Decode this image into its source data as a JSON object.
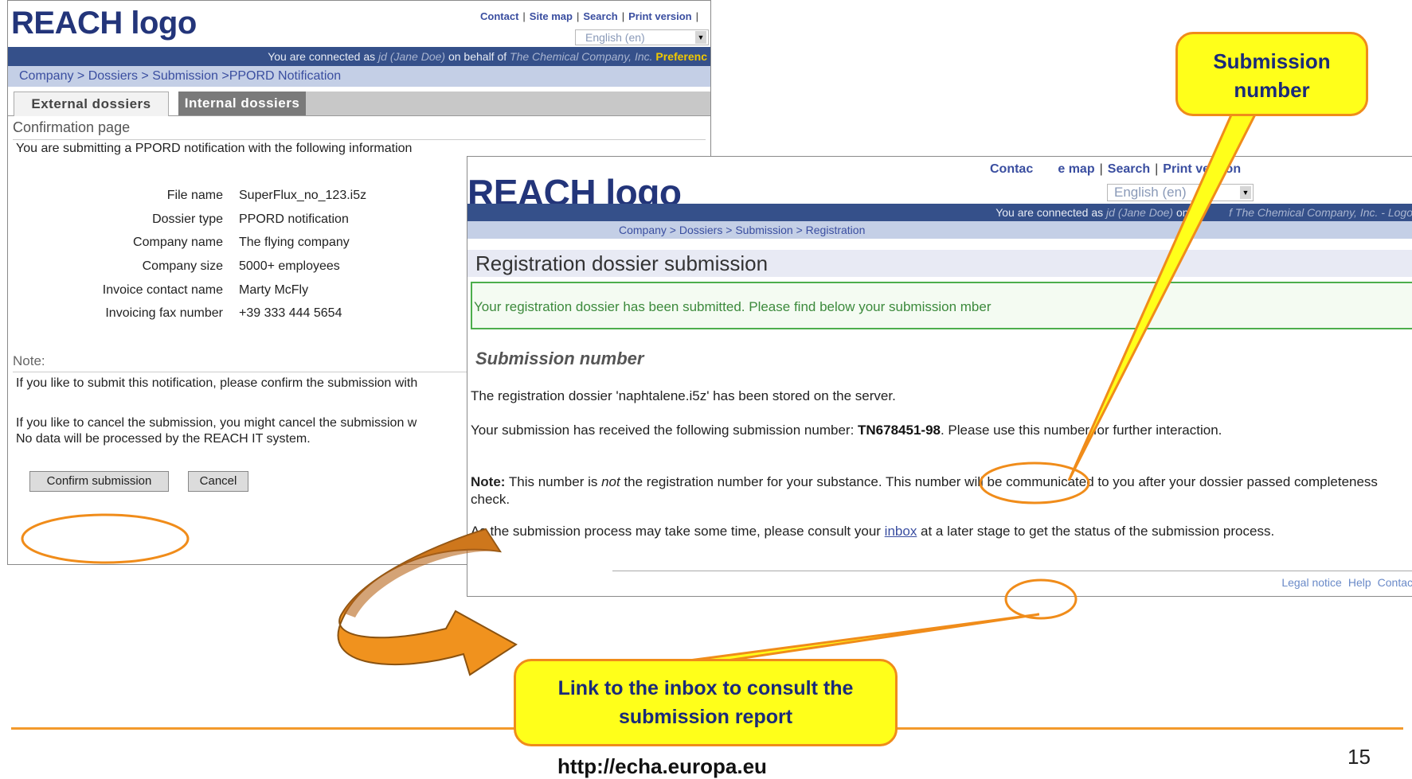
{
  "window1": {
    "logo": "REACH logo",
    "top_links": [
      "Contact",
      "Site map",
      "Search",
      "Print version"
    ],
    "language": "English (en)",
    "connected_prefix": "You are connected as ",
    "connected_user": "jd (Jane Doe)",
    "connected_mid": " on behalf of ",
    "connected_company": "The Chemical Company, Inc.",
    "connected_pref": " Preferenc",
    "breadcrumb": [
      "Company",
      "Dossiers",
      "Submission"
    ],
    "breadcrumb_current": ">PPORD Notification",
    "tabs": {
      "external": "External dossiers",
      "internal": "Internal dossiers"
    },
    "confirmation_header": "Confirmation page",
    "intro": "You are submitting a PPORD notification with the following information",
    "fields": [
      {
        "label": "File name",
        "value": "SuperFlux_no_123.i5z"
      },
      {
        "label": "Dossier type",
        "value": "PPORD notification"
      },
      {
        "label": "Company name",
        "value": "The flying company"
      },
      {
        "label": "Company size",
        "value": "5000+ employees"
      },
      {
        "label": "Invoice contact name",
        "value": "Marty McFly"
      },
      {
        "label": "Invoicing fax number",
        "value": "+39 333 444 5654"
      }
    ],
    "note_header": "Note:",
    "note_line1": "If you like to submit this notification, please confirm the submission with",
    "note_line2a": "If you like to cancel the submission, you might cancel the submission w",
    "note_line2b": "No data will be processed by the REACH IT system.",
    "confirm_button": "Confirm submission",
    "cancel_button": "Cancel"
  },
  "window2": {
    "logo": "REACH logo",
    "top_links": [
      "Contac",
      "e map",
      "Search",
      "Print version"
    ],
    "language": "English (en)",
    "connected_prefix": "You are connected as ",
    "connected_user": "jd (Jane Doe)",
    "connected_mid": " on be",
    "connected_company": "f The Chemical Company, Inc.",
    "connected_suffix": " - Logo",
    "breadcrumb": [
      "Company",
      "Dossiers",
      "Submission"
    ],
    "breadcrumb_current": " > Registration",
    "page_title": "Registration dossier submission",
    "success_message": "Your registration dossier has been submitted. Please find below your submission   mber",
    "section_header": "Submission number",
    "p1": "The registration dossier 'naphtalene.i5z' has been stored on the server.",
    "p2_before": "Your submission has received the following submission number: ",
    "submission_number": "TN678451-98",
    "p2_after": ". Please use this number for further interaction.",
    "p3_label": "Note:",
    "p3_before": " This number is ",
    "p3_not": "not",
    "p3_after": " the registration number for your substance. This number will be communicated to you after your dossier passed completeness check.",
    "p4_before": "As the submission process may take some time, please consult your ",
    "p4_link": "inbox",
    "p4_after": " at a later stage to get the status of the submission process.",
    "footer_links": [
      "Legal notice",
      "Help",
      "Contac"
    ]
  },
  "callouts": {
    "top": "Submission number",
    "bottom": "Link to the inbox to consult the submission report"
  },
  "slide": {
    "url": "http://echa.europa.eu",
    "page_number": "15"
  },
  "colors": {
    "brand_blue": "#23357a",
    "connbar": "#35508a",
    "crumbbar": "#c4cfe6",
    "accent_orange": "#f08c1a",
    "callout_yellow": "#ffff1a",
    "success_green": "#4cae4c"
  }
}
